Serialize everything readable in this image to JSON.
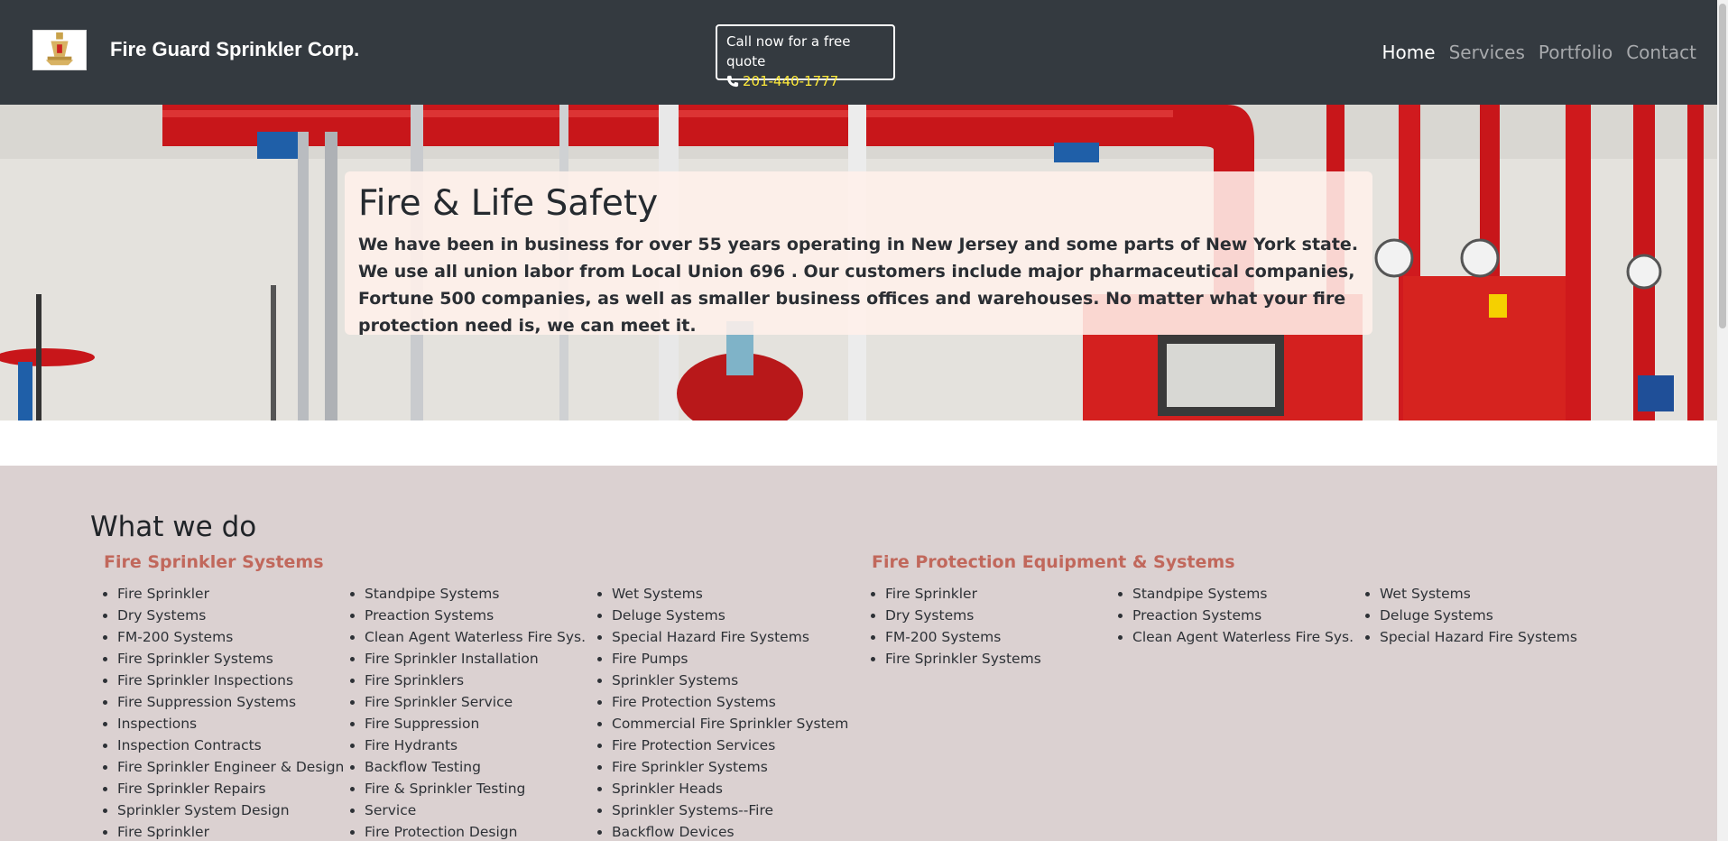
{
  "header": {
    "logo_icon": "sprinkler-head-icon",
    "brand": "Fire Guard Sprinkler Corp.",
    "quote_label": "Call now for a free quote",
    "phone_icon": "phone-icon",
    "phone": "201-440-1777",
    "nav": [
      "Home",
      "Services",
      "Portfolio",
      "Contact"
    ],
    "active_nav": "Home"
  },
  "hero": {
    "title": "Fire & Life Safety",
    "text": "We have been in business for over 55 years operating in New Jersey and some parts of New York state. We use all union labor from Local Union 696 . Our customers include major pharmaceutical companies, Fortune 500 companies, as well as smaller business offices and warehouses. No matter what your fire protection need is, we can meet it."
  },
  "services": {
    "title": "What we do",
    "categories": [
      {
        "title": "Fire Sprinkler Systems",
        "columns": [
          [
            "Fire Sprinkler",
            "Dry Systems",
            "FM-200 Systems",
            "Fire Sprinkler Systems",
            "Fire Sprinkler Inspections",
            "Fire Suppression Systems",
            "Inspections",
            "Inspection Contracts",
            "Fire Sprinkler Engineer & Design",
            "Fire Sprinkler Repairs",
            "Sprinkler System Design",
            "Fire Sprinkler"
          ],
          [
            "Standpipe Systems",
            "Preaction Systems",
            "Clean Agent Waterless Fire Sys.",
            "Fire Sprinkler Installation",
            "Fire Sprinklers",
            "Fire Sprinkler Service",
            "Fire Suppression",
            "Fire Hydrants",
            "Backflow Testing",
            "Fire & Sprinkler Testing",
            "Service",
            "Fire Protection Design"
          ],
          [
            "Wet Systems",
            "Deluge Systems",
            "Special Hazard Fire Systems",
            "Fire Pumps",
            "Sprinkler Systems",
            "Fire Protection Systems",
            "Commercial Fire Sprinkler System",
            "Fire Protection Services",
            "Fire Sprinkler Systems",
            "Sprinkler Heads",
            "Sprinkler Systems--Fire",
            "Backflow Devices"
          ]
        ]
      },
      {
        "title": "Fire Protection Equipment & Systems",
        "columns": [
          [
            "Fire Sprinkler",
            "Dry Systems",
            "FM-200 Systems",
            "Fire Sprinkler Systems"
          ],
          [
            "Standpipe Systems",
            "Preaction Systems",
            "Clean Agent Waterless Fire Sys."
          ],
          [
            "Wet Systems",
            "Deluge Systems",
            "Special Hazard Fire Systems"
          ]
        ]
      }
    ]
  },
  "colors": {
    "header_bg": "#343a40",
    "phone": "#ffea3a",
    "category_title": "#c1685c",
    "services_bg": "#dbd1d1"
  }
}
